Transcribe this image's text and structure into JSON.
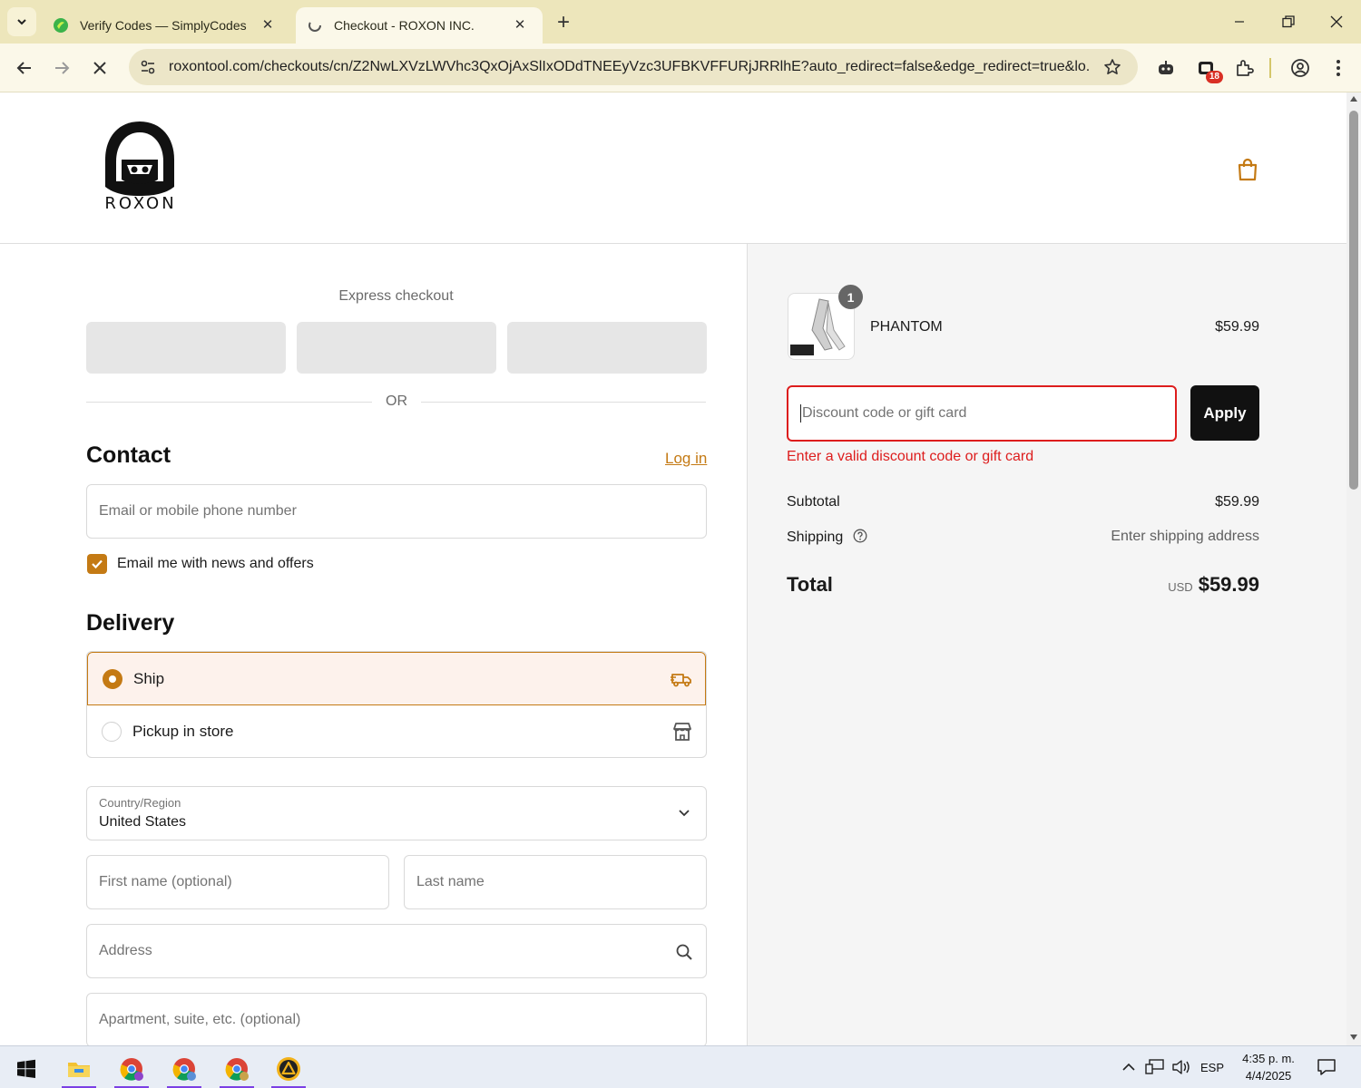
{
  "browser": {
    "tabs": [
      {
        "title": "Verify Codes — SimplyCodes",
        "active": false
      },
      {
        "title": "Checkout - ROXON INC.",
        "active": true
      }
    ],
    "url": "roxontool.com/checkouts/cn/Z2NwLXVzLWVhc3QxOjAxSlIxODdTNEEyVzc3UFBKVFFURjJRRlhE?auto_redirect=false&edge_redirect=true&lo...",
    "extension_badge": "18"
  },
  "store": {
    "logo_text": "ROXON"
  },
  "checkout": {
    "express_title": "Express checkout",
    "or_label": "OR",
    "contact": {
      "title": "Contact",
      "login_label": "Log in",
      "email_placeholder": "Email or mobile phone number",
      "newsletter_label": "Email me with news and offers",
      "newsletter_checked": true
    },
    "delivery": {
      "title": "Delivery",
      "options": [
        {
          "label": "Ship",
          "selected": true,
          "icon": "truck-icon"
        },
        {
          "label": "Pickup in store",
          "selected": false,
          "icon": "store-icon"
        }
      ],
      "country_label": "Country/Region",
      "country_value": "United States",
      "first_name_placeholder": "First name (optional)",
      "last_name_placeholder": "Last name",
      "address_placeholder": "Address",
      "apartment_placeholder": "Apartment, suite, etc. (optional)"
    }
  },
  "summary": {
    "product": {
      "name": "PHANTOM",
      "price": "$59.99",
      "quantity": "1"
    },
    "discount_placeholder": "Discount code or gift card",
    "apply_label": "Apply",
    "error_message": "Enter a valid discount code or gift card",
    "subtotal_label": "Subtotal",
    "subtotal_value": "$59.99",
    "shipping_label": "Shipping",
    "shipping_value": "Enter shipping address",
    "total_label": "Total",
    "total_currency": "USD",
    "total_value": "$59.99"
  },
  "taskbar": {
    "language": "ESP",
    "time": "4:35 p. m.",
    "date": "4/4/2025"
  },
  "colors": {
    "accent": "#c47a14",
    "error": "#dd1d1d",
    "tabbar": "#ede6bb"
  }
}
